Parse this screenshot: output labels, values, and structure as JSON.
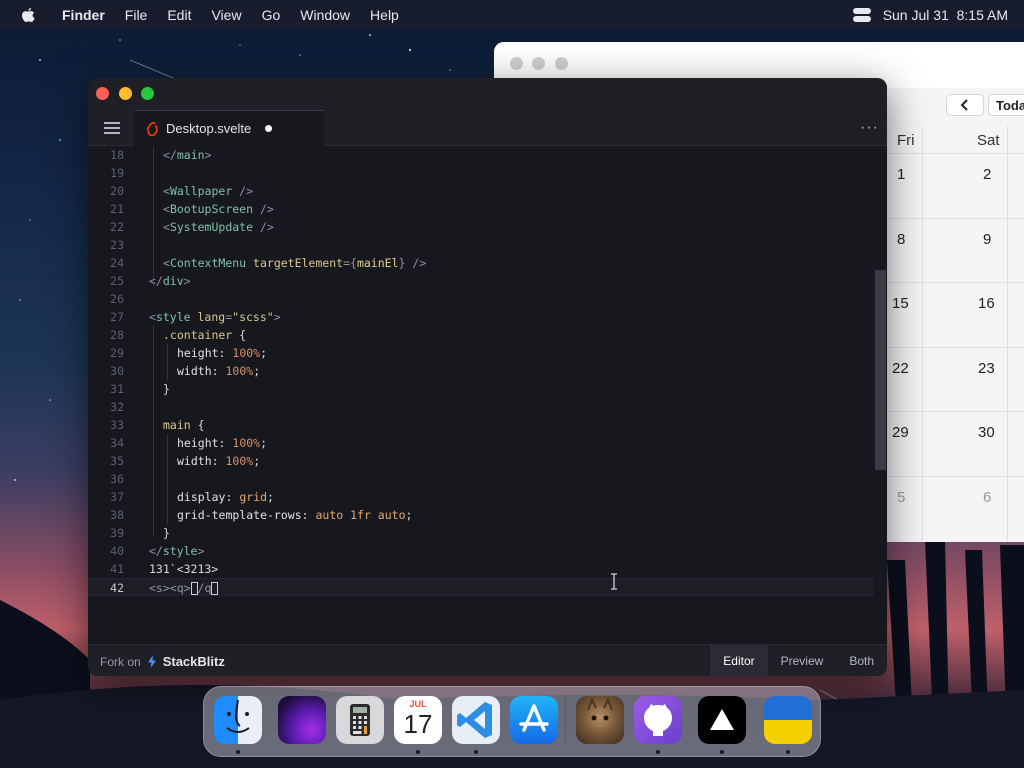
{
  "menubar": {
    "apple_icon": "apple-icon",
    "items": [
      "Finder",
      "File",
      "Edit",
      "View",
      "Go",
      "Window",
      "Help"
    ],
    "datetime": "Sun Jul 31  8:15 AM"
  },
  "calendar": {
    "today_label": "Toda",
    "day_headers": [
      "Fri",
      "Sat"
    ],
    "weeks": [
      [
        "1",
        "2"
      ],
      [
        "8",
        "9"
      ],
      [
        "15",
        "16"
      ],
      [
        "22",
        "23"
      ],
      [
        "29",
        "30"
      ],
      [
        "5",
        "6"
      ]
    ]
  },
  "editor": {
    "tab_label": "Desktop.svelte",
    "more_label": "···",
    "lines": [
      {
        "n": "18"
      },
      {
        "n": "19"
      },
      {
        "n": "20"
      },
      {
        "n": "21"
      },
      {
        "n": "22"
      },
      {
        "n": "23"
      },
      {
        "n": "24"
      },
      {
        "n": "25"
      },
      {
        "n": "26"
      },
      {
        "n": "27"
      },
      {
        "n": "28"
      },
      {
        "n": "29"
      },
      {
        "n": "30"
      },
      {
        "n": "31"
      },
      {
        "n": "32"
      },
      {
        "n": "33"
      },
      {
        "n": "34"
      },
      {
        "n": "35"
      },
      {
        "n": "36"
      },
      {
        "n": "37"
      },
      {
        "n": "38"
      },
      {
        "n": "39"
      },
      {
        "n": "40"
      },
      {
        "n": "41"
      },
      {
        "n": "42"
      }
    ],
    "code": {
      "l18": [
        "</",
        "main",
        ">"
      ],
      "l20": [
        "<",
        "Wallpaper",
        " />"
      ],
      "l21": [
        "<",
        "BootupScreen",
        " />"
      ],
      "l22": [
        "<",
        "SystemUpdate",
        " />"
      ],
      "l24": [
        "<",
        "ContextMenu",
        " ",
        "targetElement",
        "=",
        "{",
        "mainEl",
        "}",
        " />"
      ],
      "l25": [
        "</",
        "div",
        ">"
      ],
      "l27": [
        "<",
        "style",
        " ",
        "lang",
        "=",
        "\"scss\"",
        ">"
      ],
      "l28": [
        ".container",
        " {"
      ],
      "l29": [
        "height",
        ": ",
        "100%",
        ";"
      ],
      "l30": [
        "width",
        ": ",
        "100%",
        ";"
      ],
      "l31": [
        "}"
      ],
      "l33": [
        "main",
        " {"
      ],
      "l34": [
        "height",
        ": ",
        "100%",
        ";"
      ],
      "l35": [
        "width",
        ": ",
        "100%",
        ";"
      ],
      "l37": [
        "display",
        ": ",
        "grid",
        ";"
      ],
      "l38": [
        "grid-template-rows",
        ": ",
        "auto 1fr auto",
        ";"
      ],
      "l39": [
        "}"
      ],
      "l40": [
        "</",
        "style",
        ">"
      ],
      "l41": [
        "131`<3213>"
      ],
      "l42": [
        "<s><q>",
        "/",
        "q"
      ]
    },
    "footer": {
      "fork_label": "Fork on",
      "brand": "StackBlitz",
      "view_tabs": [
        "Editor",
        "Preview",
        "Both"
      ],
      "active_tab": "Editor"
    }
  },
  "dock": {
    "apps": [
      "finder-icon",
      "purple-wallpaper-icon",
      "calculator-icon",
      "calendar-icon",
      "vscode-icon",
      "app-store-icon",
      "cat-photo-icon",
      "github-icon",
      "vercel-icon",
      "ukraine-flag-icon"
    ],
    "calendar_month": "JUL",
    "calendar_day": "17"
  }
}
